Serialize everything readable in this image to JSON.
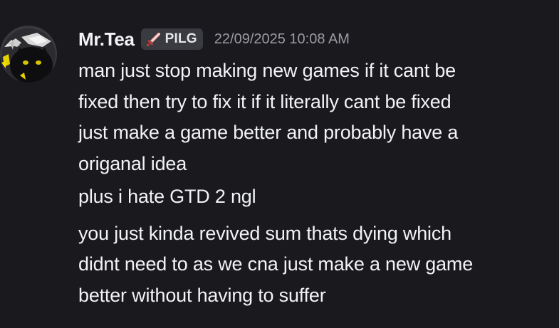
{
  "message": {
    "author": {
      "name": "Mr.Tea",
      "avatar_icon": "cat-avatar-icon",
      "guild_tag": {
        "icon": "crossed-swords-icon",
        "label": "PILG"
      }
    },
    "timestamp": "22/09/2025 10:08 AM",
    "groups": [
      {
        "lines": [
          "man just stop making new games if it cant be",
          "fixed then try to fix it if it literally cant be fixed",
          "just make a game better and probably have a",
          "origanal idea"
        ]
      },
      {
        "lines": [
          "plus i hate GTD 2 ngl"
        ]
      },
      {
        "lines": [
          "you just kinda revived sum thats dying which",
          "didnt need to as we cna just make a new game",
          "better without having to suffer"
        ]
      }
    ]
  },
  "colors": {
    "background": "#1a1a1e",
    "text": "#f2f3f5",
    "muted": "#9a9ba3",
    "tag_background": "#3a3a41"
  }
}
